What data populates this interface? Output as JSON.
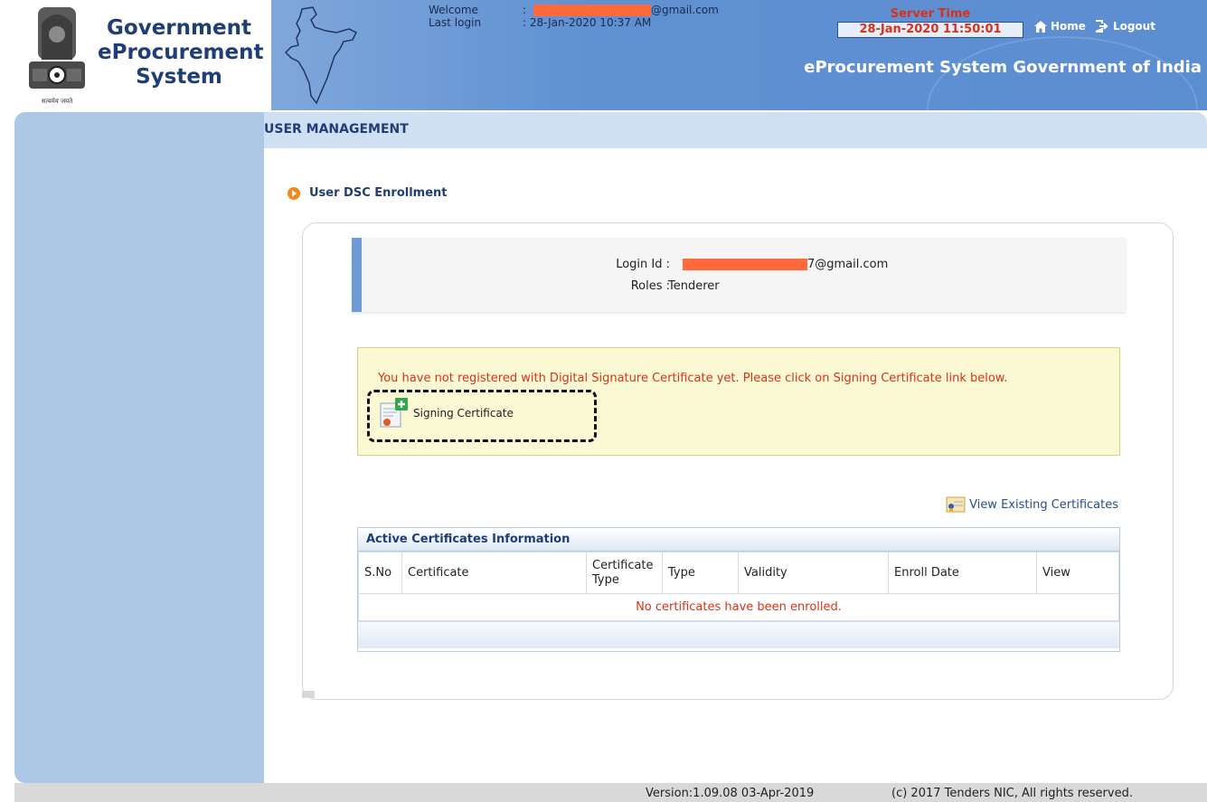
{
  "header": {
    "brand_lines": [
      "Government",
      "eProcurement",
      "System"
    ],
    "emblem_motto": "सत्यमेव जयते",
    "welcome_label": "Welcome",
    "welcome_value_suffix": "@gmail.com",
    "last_login_label": "Last login",
    "last_login_value": ": 28-Jan-2020 10:37 AM",
    "colon": ":",
    "server_time_label": "Server Time",
    "server_time_value": "28-Jan-2020 11:50:01",
    "home_label": "Home",
    "logout_label": "Logout",
    "tagline": "eProcurement System Government of India"
  },
  "page": {
    "title": "USER MANAGEMENT",
    "section_heading": "User DSC Enrollment"
  },
  "user_info": {
    "login_label": "Login Id :",
    "login_value_suffix": "7@gmail.com",
    "roles_label": "Roles :",
    "roles_value": "Tenderer"
  },
  "notice": {
    "message": "You have not registered with Digital Signature Certificate yet. Please click on Signing Certificate link below.",
    "signing_link": "Signing Certificate"
  },
  "view_existing_link": "View Existing Certificates",
  "certificates_table": {
    "title": "Active Certificates Information",
    "columns": [
      "S.No",
      "Certificate",
      "Certificate Type",
      "Type",
      "Validity",
      "Enroll Date",
      "View"
    ],
    "empty_message": "No certificates have been enrolled."
  },
  "footer": {
    "version": "Version:1.09.08 03-Apr-2019",
    "copyright": "(c) 2017 Tenders NIC, All rights reserved."
  },
  "colors": {
    "header_blue": "#5b8ed1",
    "brand_navy": "#1f3e76",
    "alert_red": "#d8331a",
    "redaction": "#ff6a3d",
    "sidebar": "#adc8e6"
  }
}
